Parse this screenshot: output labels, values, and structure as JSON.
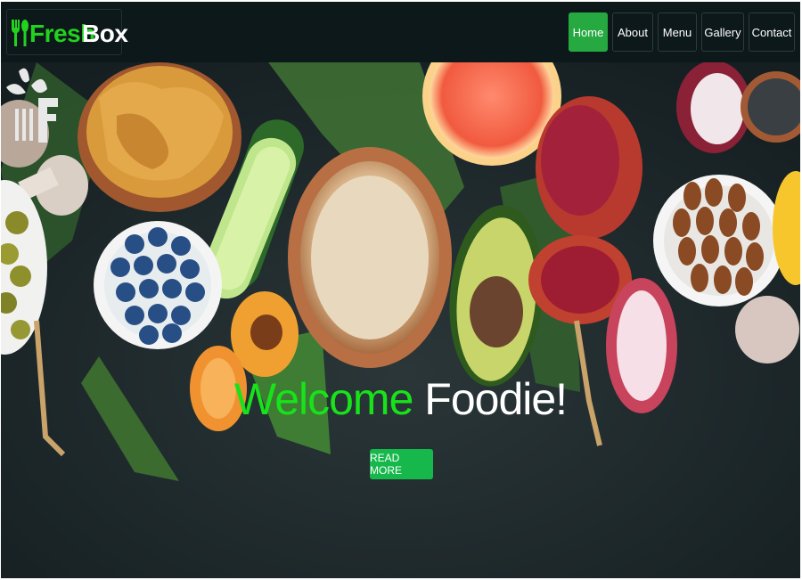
{
  "brand": {
    "part1": "Fresh",
    "part2": "Box",
    "logo_icon": "fork-spoon-icon"
  },
  "nav": {
    "items": [
      {
        "label": "Home",
        "active": true
      },
      {
        "label": "About",
        "active": false
      },
      {
        "label": "Menu",
        "active": false
      },
      {
        "label": "Gallery",
        "active": false
      },
      {
        "label": "Contact",
        "active": false
      }
    ]
  },
  "hero": {
    "headline_part1": "Welcome",
    "headline_part2": "Foodie!",
    "cta_label": "READ MORE",
    "watermark_icon": "leaf-fork-icon"
  },
  "colors": {
    "brand_green": "#22d21e",
    "nav_active": "#26a941",
    "cta_bg": "#16b84c",
    "headline_green": "#18e21a",
    "navbar_bg": "#0d181b"
  }
}
